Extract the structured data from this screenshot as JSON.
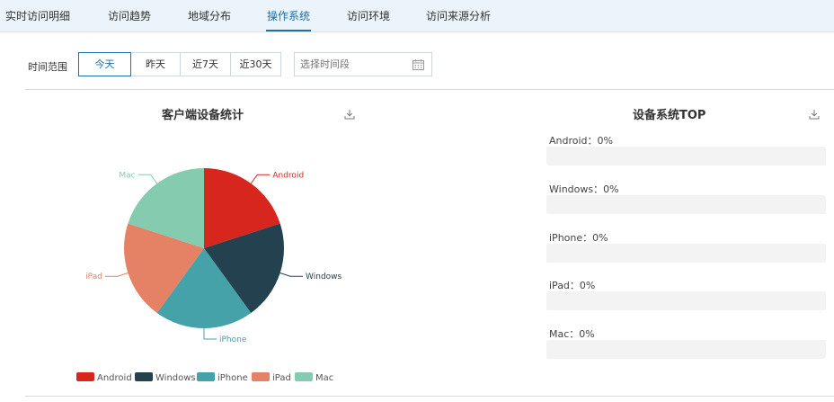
{
  "tabs": [
    {
      "label": "实时访问明细",
      "active": false
    },
    {
      "label": "访问趋势",
      "active": false
    },
    {
      "label": "地域分布",
      "active": false
    },
    {
      "label": "操作系统",
      "active": true
    },
    {
      "label": "访问环境",
      "active": false
    },
    {
      "label": "访问来源分析",
      "active": false
    }
  ],
  "filter": {
    "label": "时间范围",
    "ranges": [
      "今天",
      "昨天",
      "近7天",
      "近30天"
    ],
    "active_range": "今天",
    "date_placeholder": "选择时间段"
  },
  "client_chart": {
    "title": "客户端设备统计",
    "download_icon": "download-icon",
    "chart_data": {
      "type": "pie",
      "categories": [
        "Android",
        "Windows",
        "iPhone",
        "iPad",
        "Mac"
      ],
      "values": [
        1,
        1,
        1,
        1,
        1
      ],
      "colors": [
        "#d7261e",
        "#23414f",
        "#45a2a9",
        "#e58164",
        "#85cbb0"
      ],
      "legend_position": "bottom"
    }
  },
  "os_top": {
    "title": "设备系统TOP",
    "download_icon": "download-icon",
    "items": [
      {
        "label": "Android：0%",
        "percent": 0
      },
      {
        "label": "Windows：0%",
        "percent": 0
      },
      {
        "label": "iPhone：0%",
        "percent": 0
      },
      {
        "label": "iPad：0%",
        "percent": 0
      },
      {
        "label": "Mac：0%",
        "percent": 0
      }
    ]
  }
}
